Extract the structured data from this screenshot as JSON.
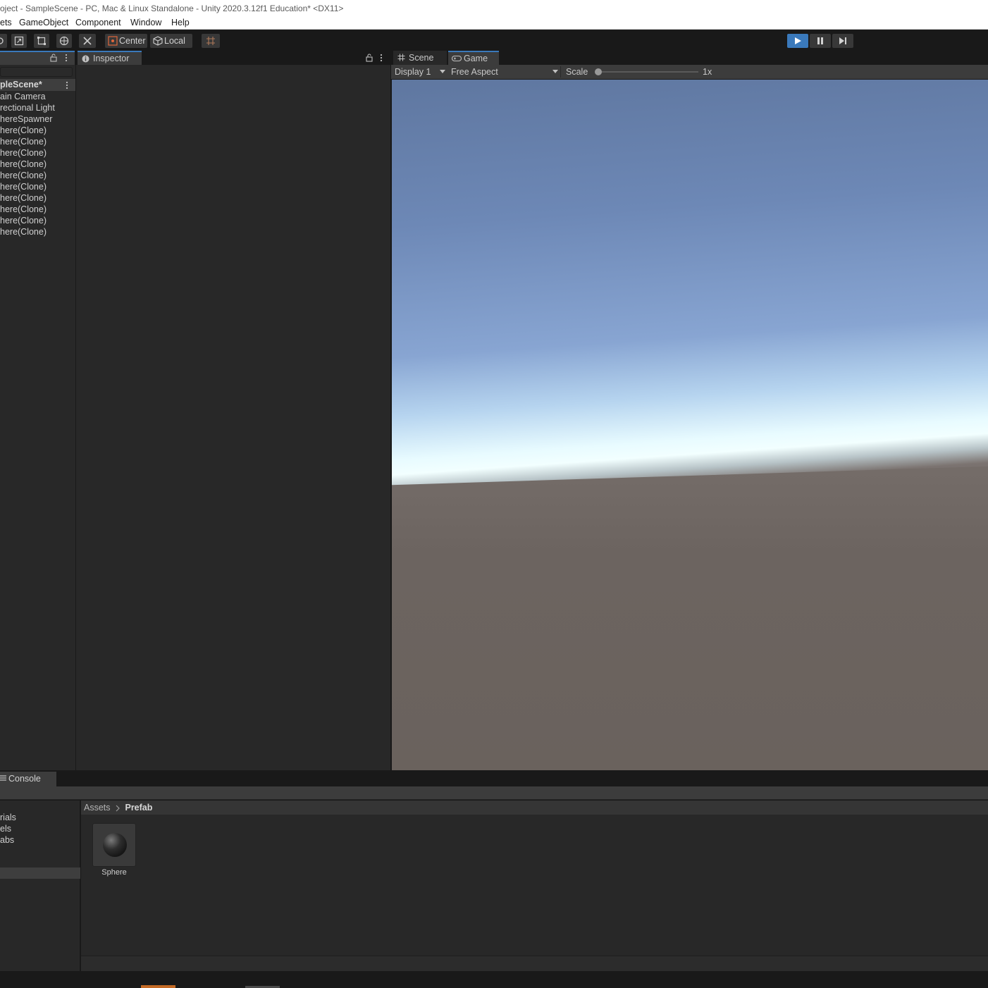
{
  "window": {
    "title": "oject - SampleScene - PC, Mac & Linux Standalone - Unity 2020.3.12f1 Education* <DX11>"
  },
  "menu": {
    "items": [
      "ets",
      "GameObject",
      "Component",
      "Window",
      "Help"
    ]
  },
  "toolbar": {
    "pivot_label": "Center",
    "space_label": "Local",
    "accent_color": "#3a79bb"
  },
  "panels": {
    "inspector_tab": "Inspector",
    "scene_tab": "Scene",
    "game_tab": "Game",
    "console_tab": "Console"
  },
  "hierarchy": {
    "scene_name": "pleScene*",
    "items": [
      "ain Camera",
      "rectional Light",
      "hereSpawner",
      "here(Clone)",
      "here(Clone)",
      "here(Clone)",
      "here(Clone)",
      "here(Clone)",
      "here(Clone)",
      "here(Clone)",
      "here(Clone)",
      "here(Clone)",
      "here(Clone)"
    ]
  },
  "game_view": {
    "display": "Display 1",
    "aspect": "Free Aspect",
    "scale_label": "Scale",
    "scale_value": "1x"
  },
  "project": {
    "folders": [
      "rials",
      "els",
      "abs"
    ],
    "breadcrumb_root": "Assets",
    "breadcrumb_current": "Prefab",
    "assets": [
      "Sphere"
    ]
  }
}
